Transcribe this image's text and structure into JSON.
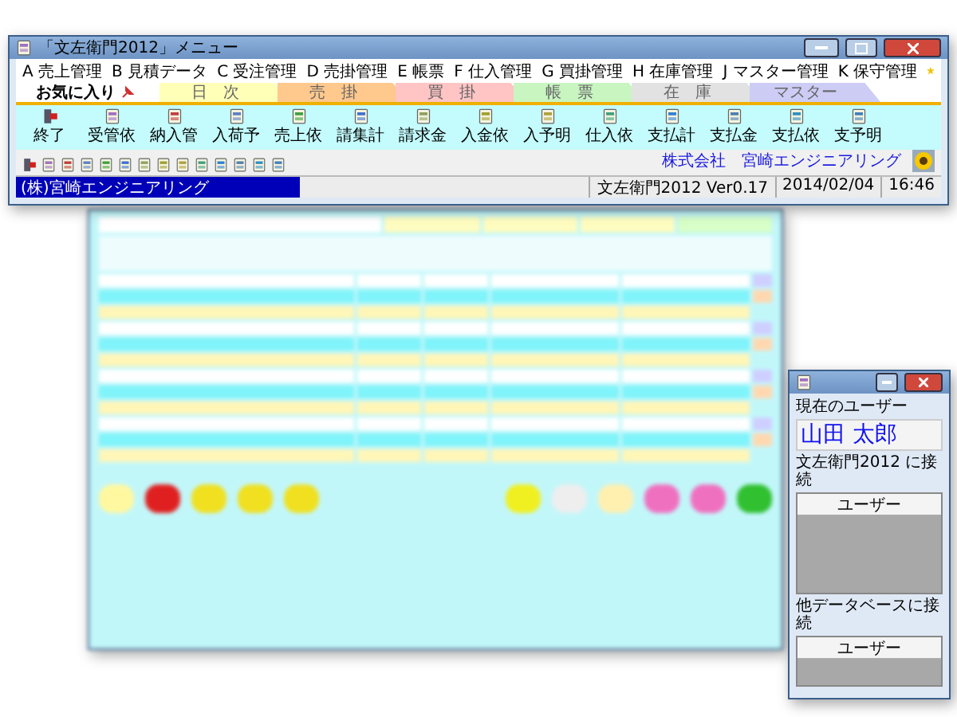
{
  "menu_window": {
    "title": "「文左衛門2012」メニュー",
    "menu": [
      "A 売上管理",
      "B 見積データ",
      "C 受注管理",
      "D 売掛管理",
      "E 帳票",
      "F 仕入管理",
      "G 買掛管理",
      "H 在庫管理",
      "J マスター管理",
      "K 保守管理"
    ],
    "tabs": [
      {
        "label": "お気に入り",
        "selected": true,
        "color": "#ffffff"
      },
      {
        "label": "日　次",
        "selected": false,
        "color": "#ffffb8"
      },
      {
        "label": "売　掛",
        "selected": false,
        "color": "#ffc88c"
      },
      {
        "label": "買　掛",
        "selected": false,
        "color": "#ffc4c4"
      },
      {
        "label": "帳　票",
        "selected": false,
        "color": "#c8f5c0"
      },
      {
        "label": "在　庫",
        "selected": false,
        "color": "#e2e2e2"
      },
      {
        "label": "マスター",
        "selected": false,
        "color": "#ccccf5"
      }
    ],
    "toolbar": [
      "終了",
      "受管依",
      "納入管",
      "入荷予",
      "売上依",
      "請集計",
      "請求金",
      "入金依",
      "入予明",
      "仕入依",
      "支払計",
      "支払金",
      "支払依",
      "支予明"
    ],
    "company_link": "株式会社　宮崎エンジニアリング",
    "status_bar": {
      "company": "(株)宮崎エンジニアリング",
      "version": "文左衛門2012 Ver0.17",
      "date": "2014/02/04",
      "time": "16:46"
    }
  },
  "user_window": {
    "current_user_label": "現在のユーザー",
    "current_user": "山田 太郎",
    "connected_label": "文左衛門2012 に接続",
    "list_header": "ユーザー",
    "other_db_label": "他データベースに接続",
    "other_list_header": "ユーザー"
  }
}
